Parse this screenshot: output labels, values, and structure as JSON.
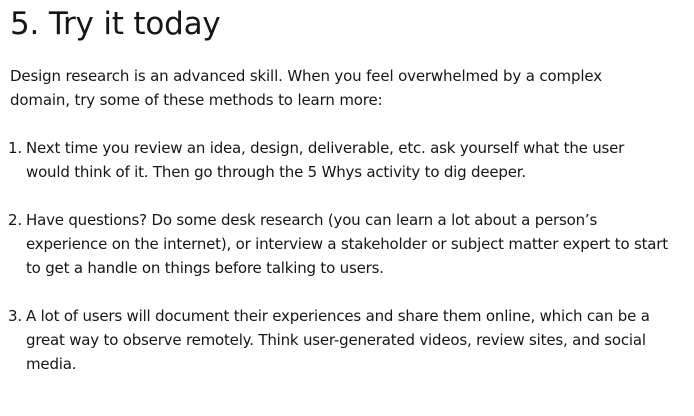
{
  "section": {
    "heading": "5. Try it today",
    "intro": "Design research is an advanced skill. When you feel overwhelmed by a complex domain, try some of these methods to learn more:"
  },
  "steps": [
    {
      "number": "1.",
      "text": "Next time you review an idea, design, deliverable, etc. ask yourself what the user would think of it. Then go through the 5 Whys activity to dig deeper."
    },
    {
      "number": "2.",
      "text": "Have questions? Do some desk research (you can learn a lot about a person’s experience on the internet), or interview a stakeholder or subject matter expert to start to get a handle on things before talking to users."
    },
    {
      "number": "3.",
      "text": "A lot of users will document their experiences and share them online, which can be a great way to observe remotely. Think user-generated videos, review sites, and social media."
    }
  ]
}
